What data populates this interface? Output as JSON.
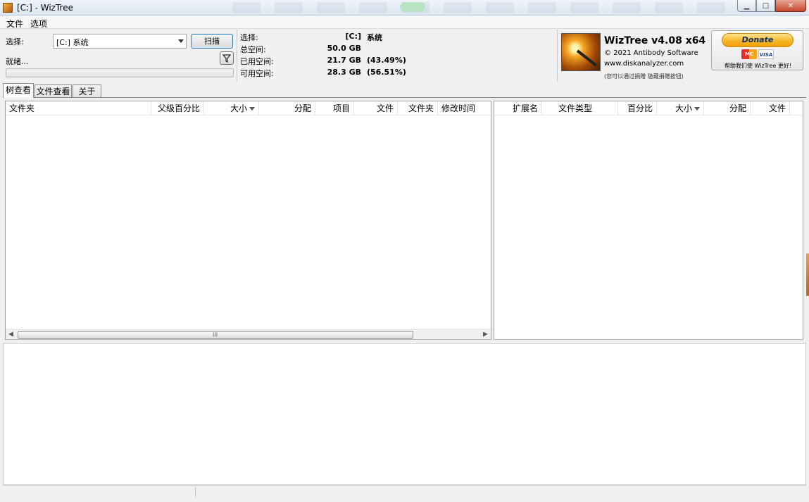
{
  "window": {
    "title": "[C:]  - WizTree",
    "buttons": {
      "minimize": "▁",
      "maximize": "□",
      "close": "✕"
    }
  },
  "menu": {
    "file": "文件",
    "options": "选项"
  },
  "scan_panel": {
    "select_label": "选择:",
    "drive_value": "[C:] 系统",
    "scan_button": "扫描",
    "status": "就绪...",
    "progress": 0
  },
  "drive_info": {
    "select_label": "选择:",
    "drive": "[C:]",
    "drive_name": "系统",
    "total_label": "总空间:",
    "total_value": "50.0 GB",
    "used_label": "已用空间:",
    "used_value": "21.7 GB",
    "used_percent": "(43.49%)",
    "free_label": "可用空间:",
    "free_value": "28.3 GB",
    "free_percent": "(56.51%)"
  },
  "about": {
    "title": "WizTree v4.08 x64",
    "copyright": "© 2021 Antibody Software",
    "website": "www.diskanalyzer.com",
    "note": "(您可以通过捐赠 隐藏捐赠按钮)"
  },
  "donate": {
    "button": "Donate",
    "card1": "MC",
    "card2": "VISA",
    "help": "帮助我们使 WizTree 更好!"
  },
  "tabs": [
    "树查看",
    "文件查看",
    "关于"
  ],
  "tree_columns": [
    "文件夹",
    "父级百分比",
    "大小",
    "分配",
    "项目",
    "文件",
    "文件夹",
    "修改时间"
  ],
  "type_columns": [
    "扩展名",
    "文件类型",
    "百分比",
    "大小",
    "分配",
    "文件"
  ],
  "scrollbar_grip": "III"
}
